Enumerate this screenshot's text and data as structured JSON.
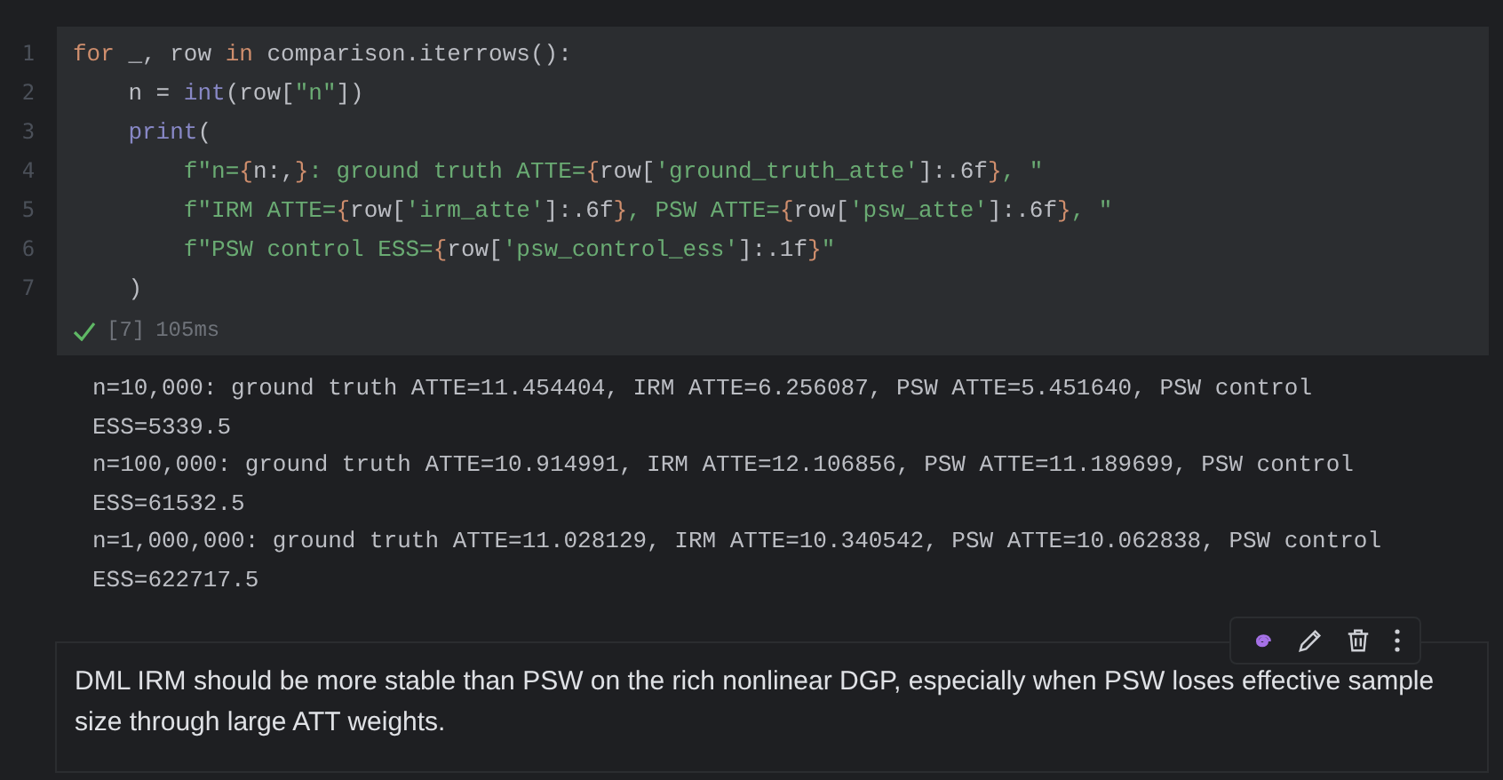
{
  "code_cell": {
    "lines": [
      {
        "number": "1",
        "tokens": [
          {
            "kind": "keyword",
            "text": "for"
          },
          {
            "kind": "plain",
            "text": " _, row "
          },
          {
            "kind": "keyword",
            "text": "in"
          },
          {
            "kind": "plain",
            "text": " comparison.iterrows():"
          }
        ]
      },
      {
        "number": "2",
        "tokens": [
          {
            "kind": "plain",
            "text": "    n = "
          },
          {
            "kind": "builtin",
            "text": "int"
          },
          {
            "kind": "plain",
            "text": "(row["
          },
          {
            "kind": "string",
            "text": "\"n\""
          },
          {
            "kind": "plain",
            "text": "])"
          }
        ]
      },
      {
        "number": "3",
        "tokens": [
          {
            "kind": "builtin",
            "text": "    print"
          },
          {
            "kind": "plain",
            "text": "("
          }
        ]
      },
      {
        "number": "4",
        "tokens": [
          {
            "kind": "string",
            "text": "        f\"n="
          },
          {
            "kind": "brace",
            "text": "{"
          },
          {
            "kind": "plain",
            "text": "n:,"
          },
          {
            "kind": "brace",
            "text": "}"
          },
          {
            "kind": "string",
            "text": ": ground truth ATTE="
          },
          {
            "kind": "brace",
            "text": "{"
          },
          {
            "kind": "plain",
            "text": "row["
          },
          {
            "kind": "string",
            "text": "'ground_truth_atte'"
          },
          {
            "kind": "plain",
            "text": "]:.6f"
          },
          {
            "kind": "brace",
            "text": "}"
          },
          {
            "kind": "string",
            "text": ", \""
          }
        ]
      },
      {
        "number": "5",
        "tokens": [
          {
            "kind": "string",
            "text": "        f\"IRM ATTE="
          },
          {
            "kind": "brace",
            "text": "{"
          },
          {
            "kind": "plain",
            "text": "row["
          },
          {
            "kind": "string",
            "text": "'irm_atte'"
          },
          {
            "kind": "plain",
            "text": "]:.6f"
          },
          {
            "kind": "brace",
            "text": "}"
          },
          {
            "kind": "string",
            "text": ", PSW ATTE="
          },
          {
            "kind": "brace",
            "text": "{"
          },
          {
            "kind": "plain",
            "text": "row["
          },
          {
            "kind": "string",
            "text": "'psw_atte'"
          },
          {
            "kind": "plain",
            "text": "]:.6f"
          },
          {
            "kind": "brace",
            "text": "}"
          },
          {
            "kind": "string",
            "text": ", \""
          }
        ]
      },
      {
        "number": "6",
        "tokens": [
          {
            "kind": "string",
            "text": "        f\"PSW control ESS="
          },
          {
            "kind": "brace",
            "text": "{"
          },
          {
            "kind": "plain",
            "text": "row["
          },
          {
            "kind": "string",
            "text": "'psw_control_ess'"
          },
          {
            "kind": "plain",
            "text": "]:.1f"
          },
          {
            "kind": "brace",
            "text": "}"
          },
          {
            "kind": "string",
            "text": "\""
          }
        ]
      },
      {
        "number": "7",
        "tokens": [
          {
            "kind": "plain",
            "text": "    )"
          }
        ]
      }
    ],
    "status": {
      "kind": "success",
      "execution_count": "[7]",
      "duration": "105ms"
    }
  },
  "output": [
    "n=10,000: ground truth ATTE=11.454404, IRM ATTE=6.256087, PSW ATTE=5.451640, PSW control ESS=5339.5",
    "n=100,000: ground truth ATTE=10.914991, IRM ATTE=12.106856, PSW ATTE=11.189699, PSW control ESS=61532.5",
    "n=1,000,000: ground truth ATTE=11.028129, IRM ATTE=10.340542, PSW ATTE=10.062838, PSW control ESS=622717.5"
  ],
  "markdown_cell": {
    "text": "DML IRM should be more stable than PSW on the rich nonlinear DGP, especially when PSW loses effective sample size through large ATT weights."
  }
}
